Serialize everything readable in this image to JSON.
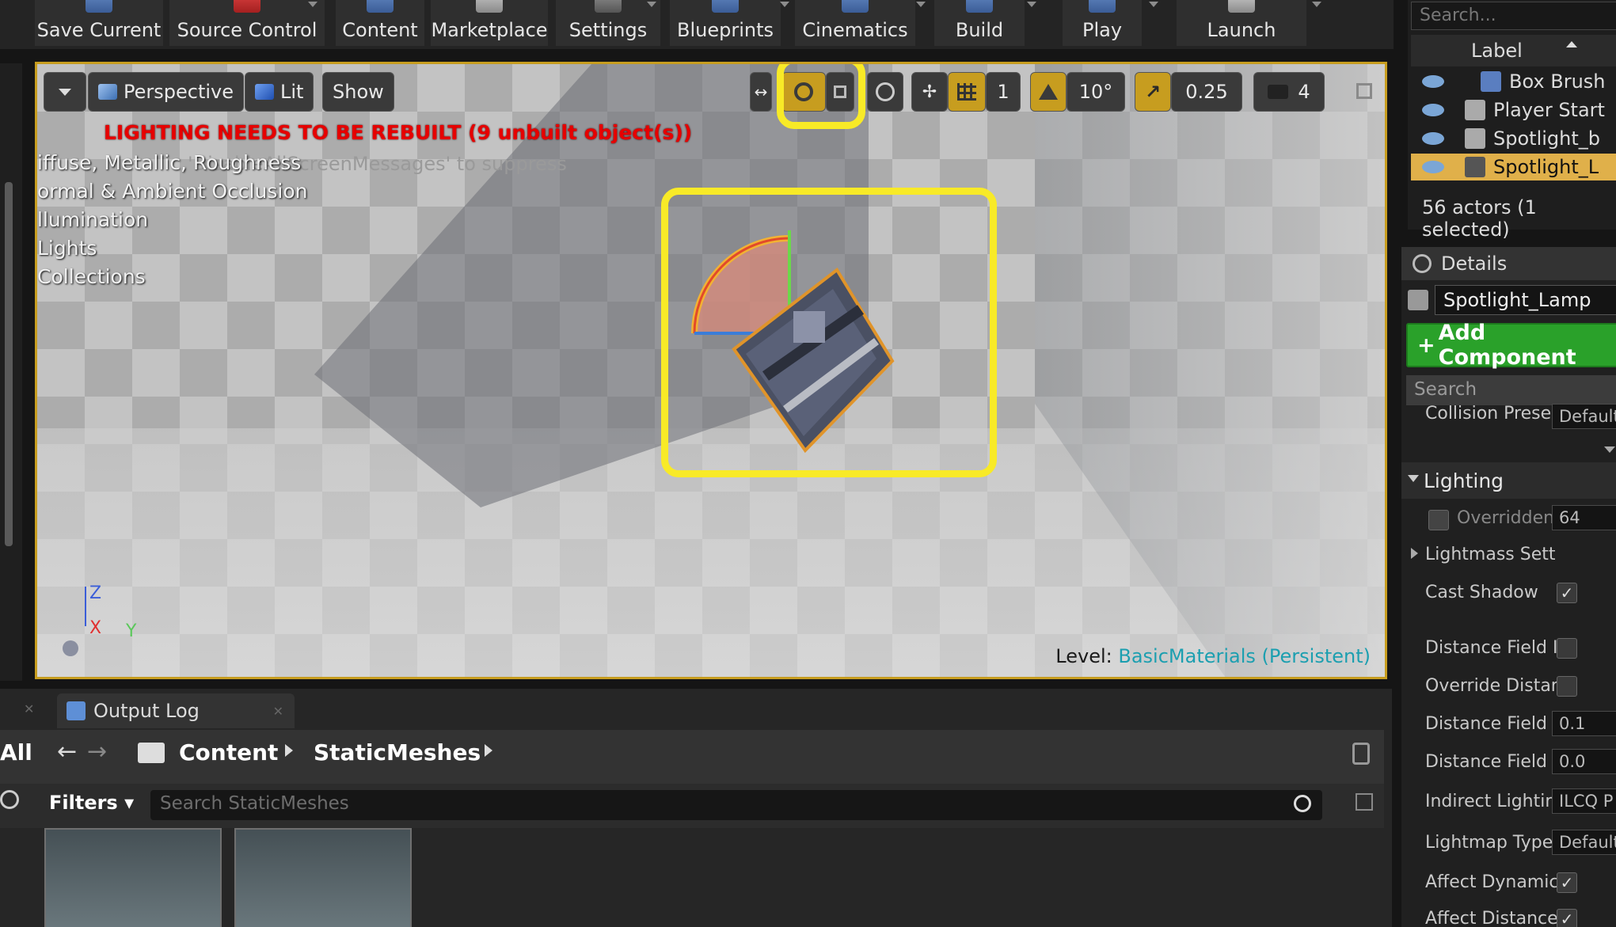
{
  "toolbar": {
    "items": [
      {
        "label": "Save Current"
      },
      {
        "label": "Source Control"
      },
      {
        "label": "Content"
      },
      {
        "label": "Marketplace"
      },
      {
        "label": "Settings"
      },
      {
        "label": "Blueprints"
      },
      {
        "label": "Cinematics"
      },
      {
        "label": "Build"
      },
      {
        "label": "Play"
      },
      {
        "label": "Launch"
      }
    ]
  },
  "viewport": {
    "view_mode": "Perspective",
    "lighting_mode": "Lit",
    "show_label": "Show",
    "grid_snap_value": "1",
    "rotation_snap_value": "10°",
    "scale_snap_value": "0.25",
    "camera_speed_value": "4",
    "warning": "LIGHTING NEEDS TO BE REBUILT (9 unbuilt object(s))",
    "suppress_hint": "'DisableAllScreenMessages' to suppress",
    "buffer_messages": [
      "iffuse, Metallic, Roughness",
      "ormal & Ambient Occlusion",
      "llumination",
      "Lights",
      "Collections"
    ],
    "axis_z": "Z",
    "axis_x": "X",
    "axis_y": "Y",
    "level_label": "Level:",
    "level_name": "BasicMaterials (Persistent)"
  },
  "bottom_panel": {
    "output_log_tab": "Output Log",
    "all_label": "All",
    "crumb_content": "Content",
    "crumb_folder": "StaticMeshes",
    "filters_label": "Filters",
    "search_placeholder": "Search StaticMeshes"
  },
  "outliner": {
    "search_placeholder": "Search...",
    "column_label": "Label",
    "rows": [
      {
        "label": "Box Brush"
      },
      {
        "label": "Player Start"
      },
      {
        "label": "Spotlight_b"
      },
      {
        "label": "Spotlight_L"
      }
    ],
    "count_text": "56 actors (1 selected)"
  },
  "details": {
    "title": "Details",
    "actor_name": "Spotlight_Lamp",
    "add_component": "Add Component",
    "search_placeholder": "Search",
    "collision_preset_label": "Collision Prese",
    "collision_preset_value": "Default",
    "section": "Lighting",
    "props": [
      {
        "label": "Overridden",
        "value": "64"
      },
      {
        "label": "Lightmass Sett",
        "value": ""
      },
      {
        "label": "Cast Shadow",
        "value": "✓"
      },
      {
        "label": "Distance Field I",
        "value": ""
      },
      {
        "label": "Override Distan",
        "value": ""
      },
      {
        "label": "Distance Field I",
        "value": "0.1"
      },
      {
        "label": "Distance Field S",
        "value": "0.0"
      },
      {
        "label": "Indirect Lighting",
        "value": "ILCQ P"
      },
      {
        "label": "Lightmap Type",
        "value": "Default"
      },
      {
        "label": "Affect Dynamic",
        "value": "✓"
      },
      {
        "label": "Affect Distance",
        "value": "✓"
      }
    ]
  }
}
